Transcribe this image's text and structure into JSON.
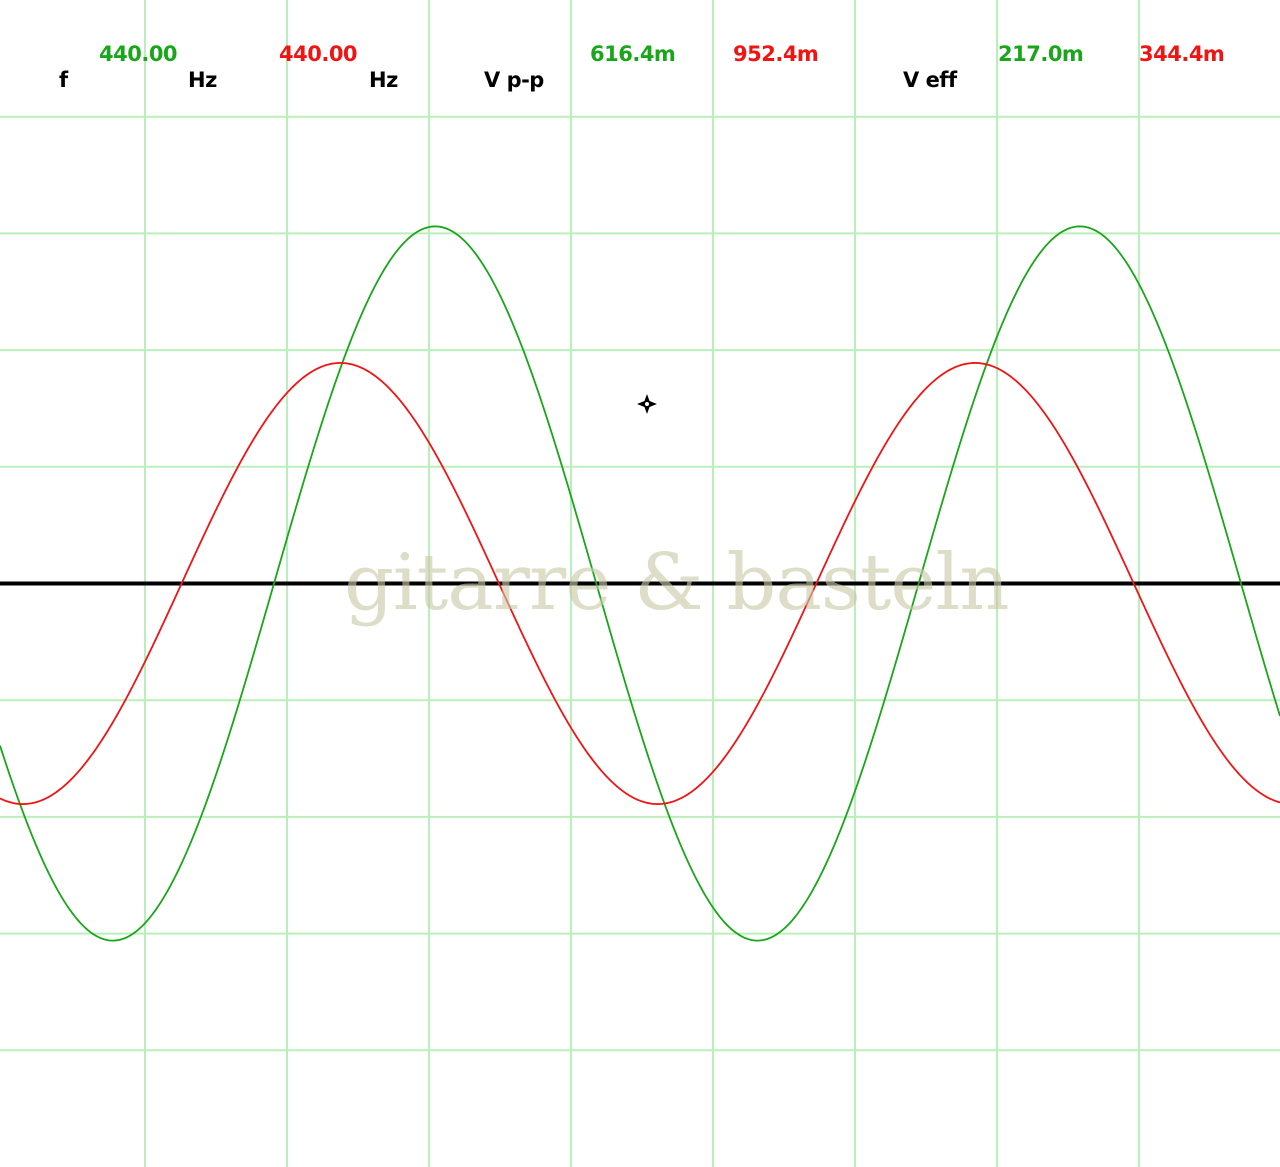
{
  "readout": {
    "freq_label": "f",
    "freq_ch1": "440.00",
    "freq_unit_1": "Hz",
    "freq_ch2": "440.00",
    "freq_unit_2": "Hz",
    "vpp_label": "V p-p",
    "vpp_ch1": "616.4m",
    "vpp_ch2": "952.4m",
    "veff_label": "V eff",
    "veff_ch1": "217.0m",
    "veff_ch2": "344.4m"
  },
  "watermark": "gitarre & basteln",
  "colors": {
    "ch1": "#1aa61a",
    "ch2": "#f01414",
    "grid": "#b9f0b9",
    "baseline": "#000000",
    "label": "#000000",
    "watermark": "#c9c9a8"
  },
  "chart_data": {
    "type": "line",
    "grid": true,
    "x": {
      "divisions": 9
    },
    "y": {
      "divisions": 10,
      "ylim": [
        -5,
        5
      ]
    },
    "series": [
      {
        "channel": "ch1",
        "color": "#1aa61a",
        "amplitude_div": 3.06,
        "period_div": 4.54,
        "phase_deg": 207
      },
      {
        "channel": "ch2",
        "color": "#f01414",
        "amplitude_div": 1.89,
        "period_div": 4.47,
        "phase_deg": 257
      }
    ],
    "cursor_icon": "crosshair-cursor-icon"
  }
}
